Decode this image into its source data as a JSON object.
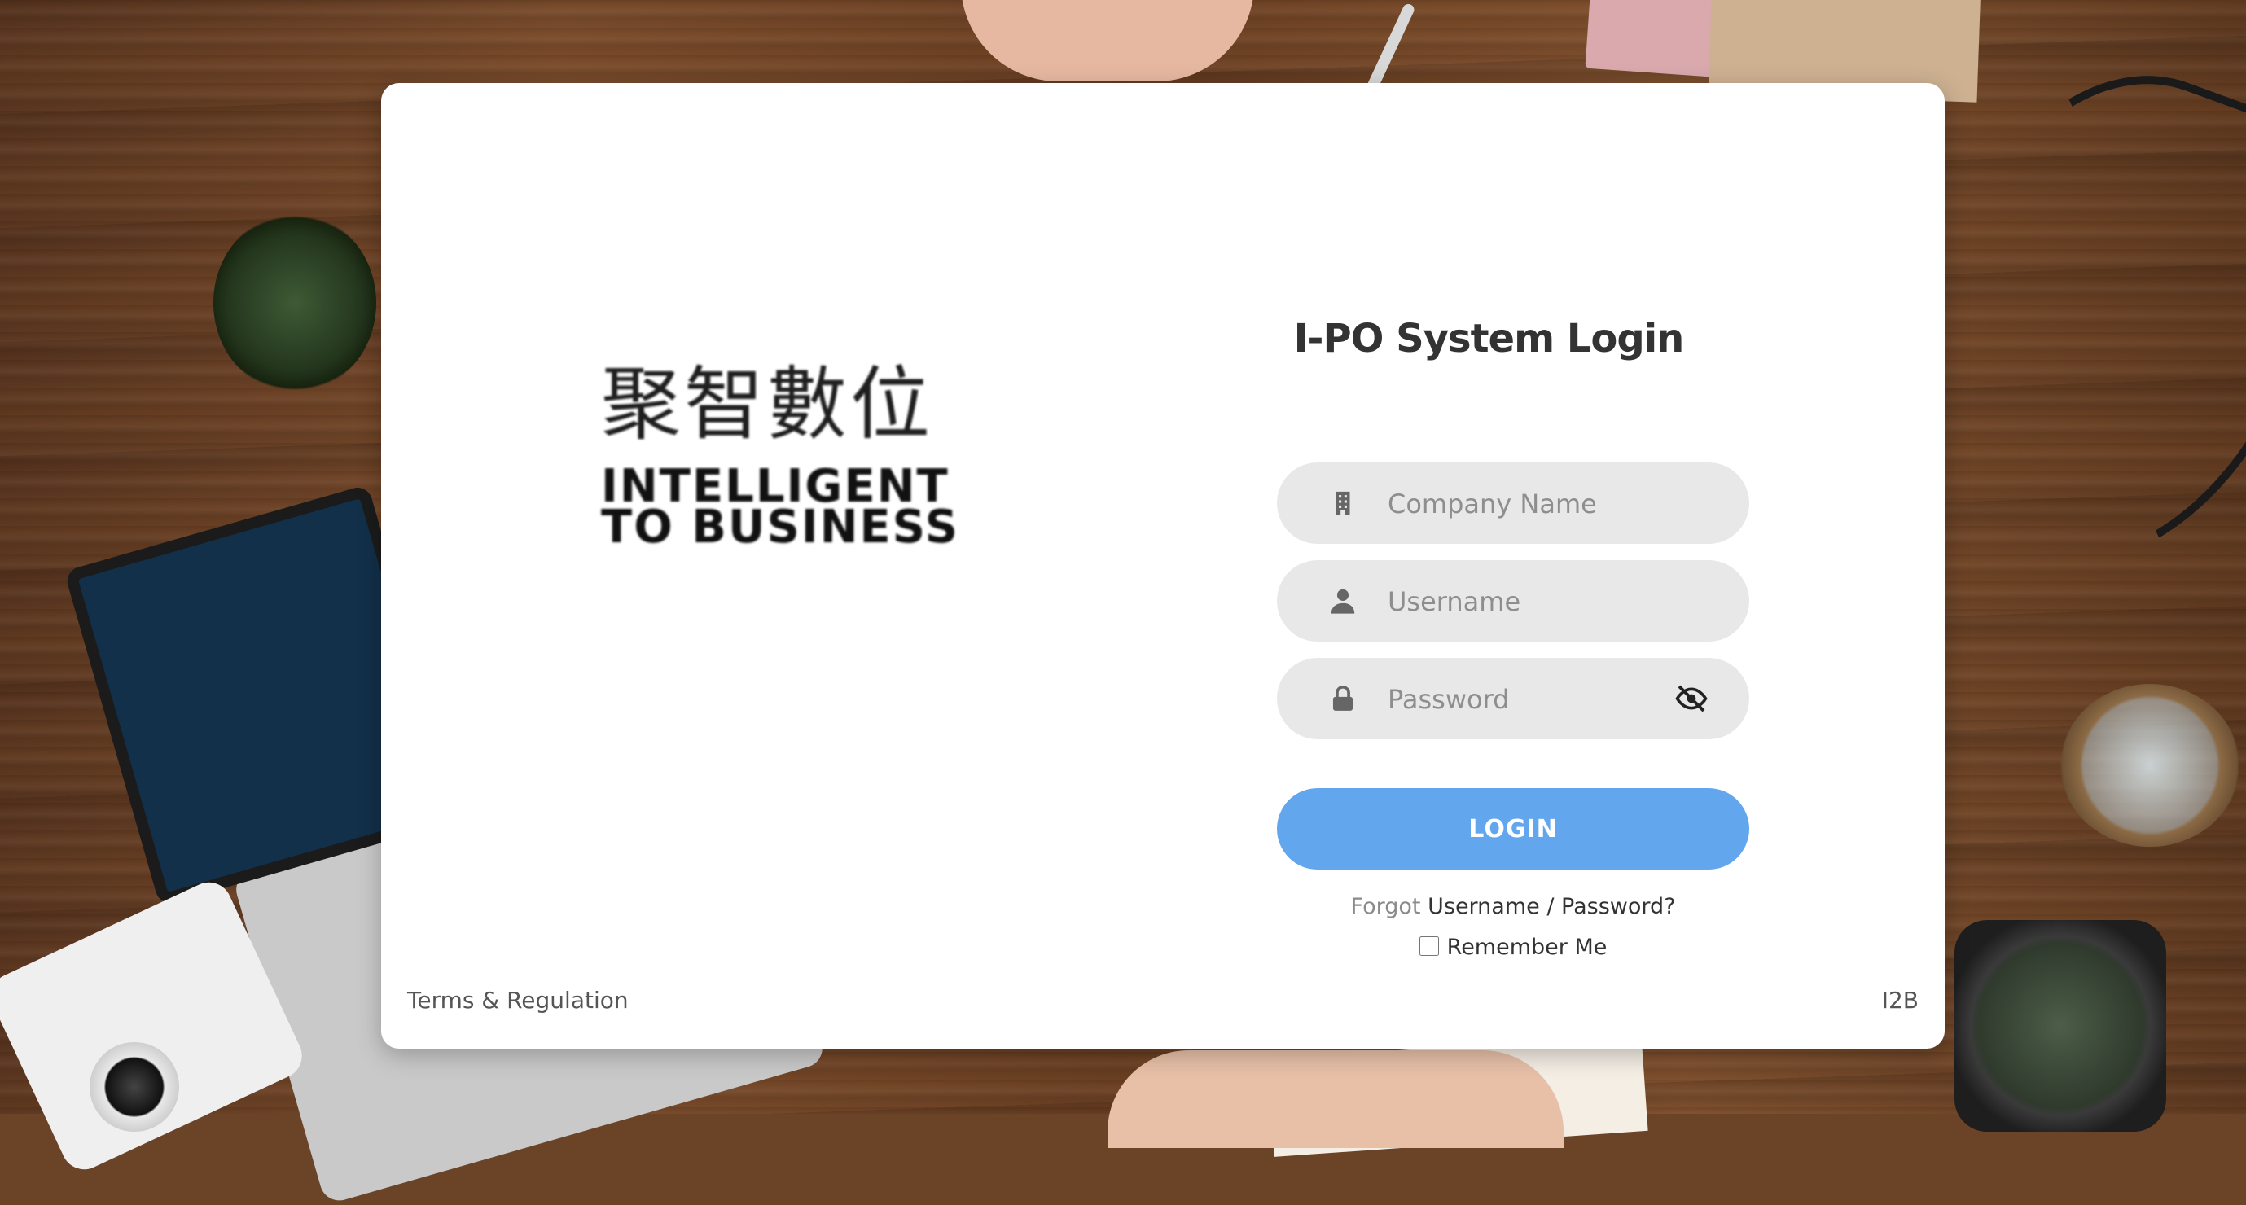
{
  "logo": {
    "chinese": "聚智數位",
    "english_line1": "INTELLIGENT",
    "english_line2": "TO BUSINESS"
  },
  "login": {
    "title": "I-PO System Login",
    "company_placeholder": "Company Name",
    "company_icon": "building-icon",
    "username_placeholder": "Username",
    "username_icon": "user-icon",
    "password_placeholder": "Password",
    "password_icon": "lock-icon",
    "toggle_icon": "eye-slash-icon",
    "button_label": "LOGIN",
    "forgot_prefix": "Forgot",
    "forgot_link": "Username / Password?",
    "remember_label": "Remember Me"
  },
  "footer": {
    "terms": "Terms & Regulation",
    "brand": "I2B"
  },
  "colors": {
    "button": "#62a7ee",
    "field_bg": "#e8e8e8",
    "title": "#333333"
  }
}
